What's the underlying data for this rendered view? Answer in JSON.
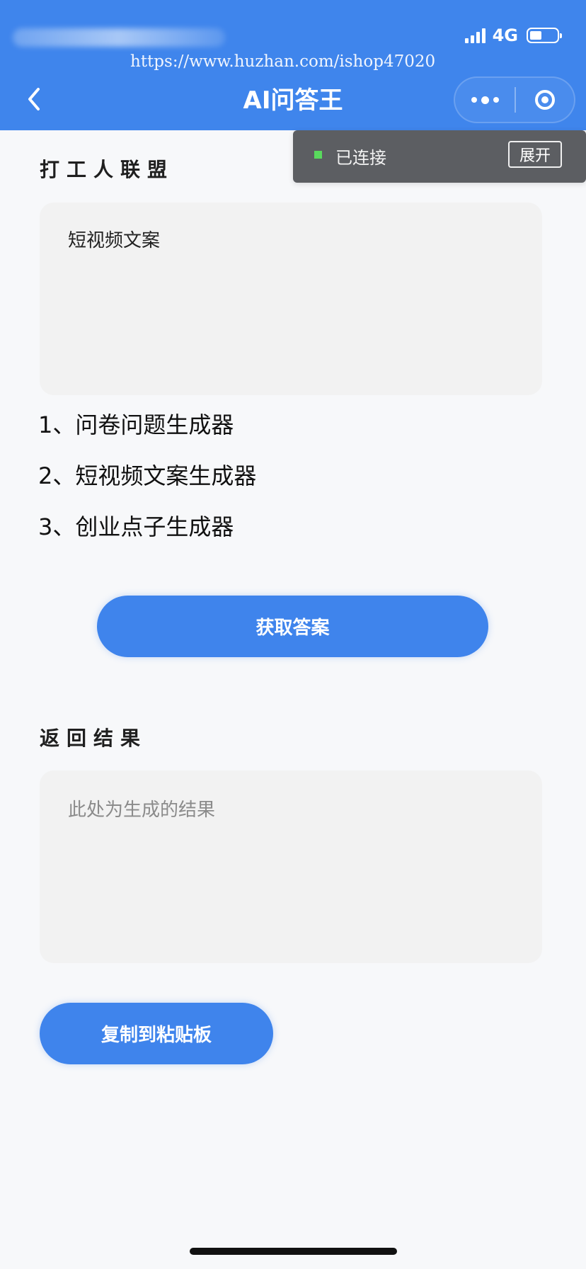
{
  "status": {
    "network": "4G"
  },
  "watermark": {
    "url_text": "https://www.huzhan.com/ishop47020"
  },
  "nav": {
    "title": "AI问答王"
  },
  "connection": {
    "status_text": "已连接",
    "expand_label": "展开",
    "status_color": "#59d95d"
  },
  "form": {
    "section_title": "打工人联盟",
    "input_value": "短视频文案",
    "options": [
      "1、问卷问题生成器",
      "2、短视频文案生成器",
      "3、创业点子生成器"
    ],
    "submit_label": "获取答案"
  },
  "result": {
    "section_title": "返回结果",
    "placeholder": "此处为生成的结果",
    "copy_label": "复制到粘贴板"
  },
  "colors": {
    "primary": "#3f85ec",
    "page_bg": "#f7f8fa",
    "box_bg": "#f2f2f2"
  },
  "icons": {
    "back": "chevron-left-icon",
    "more": "more-dots-icon",
    "close": "target-icon",
    "signal": "signal-icon",
    "battery": "battery-icon"
  }
}
